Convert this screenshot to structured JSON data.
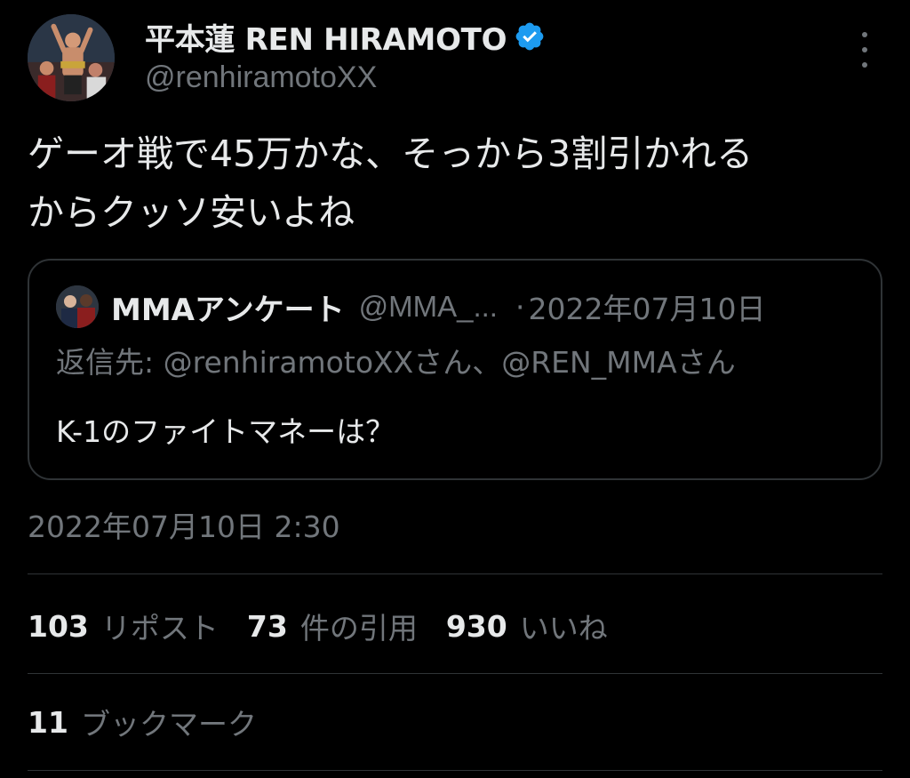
{
  "author": {
    "display_name": "平本蓮 REN HIRAMOTO",
    "handle": "@renhiramotoXX",
    "verified": true,
    "verified_color": "#1d9bf0"
  },
  "tweet": {
    "text": "ゲーオ戦で45万かな、そっから3割引かれる\nからクッソ安いよね",
    "timestamp": "2022年07月10日 2:30"
  },
  "quoted_tweet": {
    "display_name": "MMAアンケート",
    "handle": "@MMA_...",
    "separator": "·",
    "date": "2022年07月10日",
    "reply_to": "返信先: @renhiramotoXXさん、@REN_MMAさん",
    "text": "K-1のファイトマネーは？"
  },
  "stats": {
    "reposts": {
      "count": "103",
      "label": "リポスト"
    },
    "quotes": {
      "count": "73",
      "label": "件の引用"
    },
    "likes": {
      "count": "930",
      "label": "いいね"
    },
    "bookmarks": {
      "count": "11",
      "label": "ブックマーク"
    }
  },
  "icons": {
    "more": "more-options-icon",
    "verified": "verified-badge-icon"
  },
  "colors": {
    "background": "#000000",
    "primary_text": "#e7e9ea",
    "secondary_text": "#71767b",
    "border": "#2f3336"
  }
}
